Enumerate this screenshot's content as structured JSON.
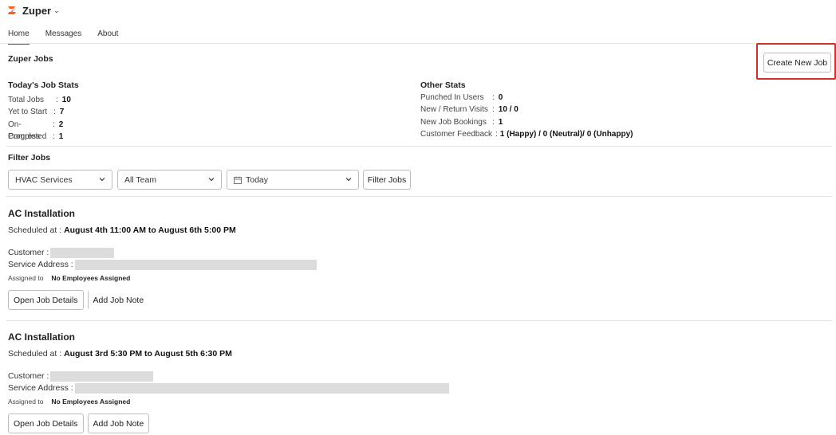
{
  "app": {
    "title": "Zuper",
    "logo_icon": "zuper-logo-icon",
    "brand_color": "#f26522"
  },
  "tabs": [
    {
      "label": "Home",
      "active": true
    },
    {
      "label": "Messages",
      "active": false
    },
    {
      "label": "About",
      "active": false
    }
  ],
  "header": {
    "title": "Zuper Jobs",
    "create_label": "Create New Job"
  },
  "today_stats": {
    "heading": "Today's Job Stats",
    "rows": [
      {
        "label": "Total Jobs",
        "value": "10"
      },
      {
        "label": "Yet to Start",
        "value": "7"
      },
      {
        "label": "On-Progress",
        "value": "2"
      },
      {
        "label": "Completed",
        "value": "1"
      }
    ]
  },
  "other_stats": {
    "heading": "Other Stats",
    "rows": [
      {
        "label": "Punched In Users",
        "value": "0"
      },
      {
        "label": "New / Return Visits",
        "value": "10 / 0"
      },
      {
        "label": "New Job Bookings",
        "value": "1"
      },
      {
        "label": "Customer Feedback",
        "value": "1 (Happy) / 0 (Neutral)/ 0 (Unhappy)"
      }
    ]
  },
  "filters": {
    "title": "Filter Jobs",
    "service": "HVAC Services",
    "team": "All Team",
    "date": "Today",
    "button_label": "Filter Jobs"
  },
  "jobs": [
    {
      "title": "AC Installation",
      "sched_prefix": "Scheduled at :",
      "sched_value": "August 4th 11:00 AM to August 6th 5:00 PM",
      "customer_label": "Customer :",
      "address_label": "Service Address :",
      "assigned_label": "Assigned to",
      "assigned_value": "No Employees Assigned",
      "open_label": "Open Job Details",
      "note_label": "Add Job Note"
    },
    {
      "title": "AC Installation",
      "sched_prefix": "Scheduled at :",
      "sched_value": "August 3rd 5:30 PM to August 5th 6:30 PM",
      "customer_label": "Customer :",
      "address_label": "Service Address :",
      "assigned_label": "Assigned to",
      "assigned_value": "No Employees Assigned",
      "open_label": "Open Job Details",
      "note_label": "Add Job Note"
    }
  ]
}
